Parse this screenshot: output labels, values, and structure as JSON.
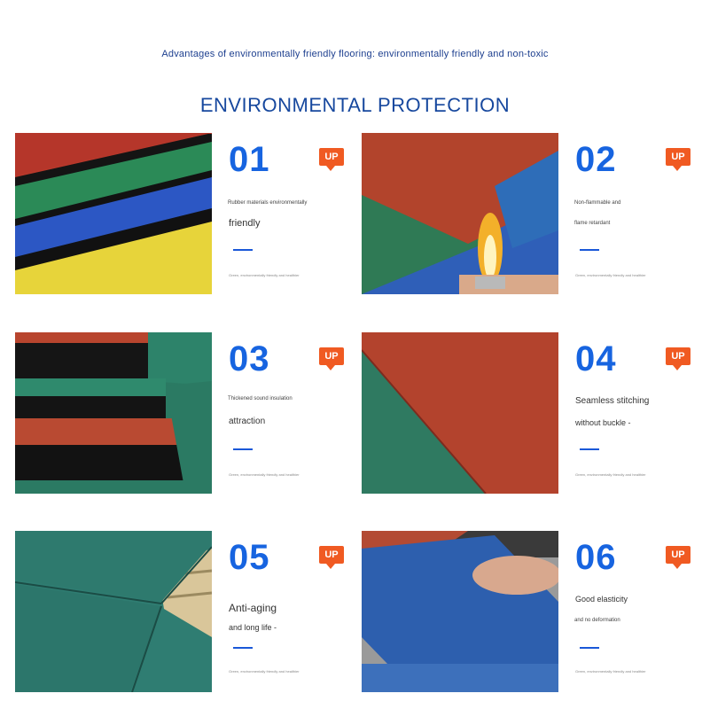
{
  "header": {
    "subtitle": "Advantages of environmentally friendly flooring: environmentally friendly and non-toxic",
    "title": "ENVIRONMENTAL PROTECTION"
  },
  "colors": {
    "accent_blue": "#1764e0",
    "badge_orange": "#f05a22",
    "title_blue": "#17489e"
  },
  "features": [
    {
      "number": "01",
      "badge": "UP",
      "line1": "Rubber materials environmentally",
      "line2": "friendly",
      "note": "Green, environmentally friendly and healthier"
    },
    {
      "number": "02",
      "badge": "UP",
      "line1": "Non-flammable and",
      "line2": "flame retardant",
      "note": "Green, environmentally friendly and healthier"
    },
    {
      "number": "03",
      "badge": "UP",
      "line1": "Thickened sound insulation",
      "line2": "attraction",
      "note": "Green, environmentally friendly and healthier"
    },
    {
      "number": "04",
      "badge": "UP",
      "line1": "Seamless stitching",
      "line2": "without buckle -",
      "note": "Green, environmentally friendly and healthier"
    },
    {
      "number": "05",
      "badge": "UP",
      "line1": "Anti-aging",
      "line2": "and long life -",
      "note": "Green, environmentally friendly and healthier"
    },
    {
      "number": "06",
      "badge": "UP",
      "line1": "Good elasticity",
      "line2": "and no deformation",
      "note": "Green, environmentally friendly and healthier"
    }
  ]
}
